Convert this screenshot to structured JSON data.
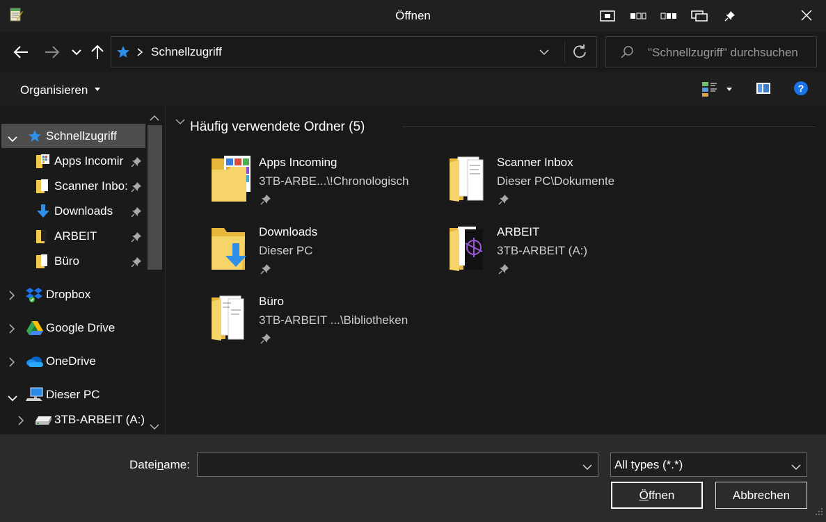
{
  "window": {
    "title": "Öffnen",
    "title_buttons": [
      "window-snap-icon",
      "window-group-icon",
      "window-group2-icon",
      "window-cascade-icon",
      "pin-icon"
    ],
    "close_icon": "close-icon"
  },
  "nav": {
    "back_icon": "back-arrow-icon",
    "forward_icon": "forward-arrow-icon",
    "recent_icon": "chevron-down-icon",
    "up_icon": "up-arrow-icon",
    "address": {
      "icon": "star-icon",
      "path": "Schnellzugriff"
    },
    "search": {
      "placeholder": "\"Schnellzugriff\" durchsuchen"
    }
  },
  "toolbar": {
    "organize_label": "Organisieren"
  },
  "sidebar": {
    "quick_access": {
      "label": "Schnellzugriff",
      "items": [
        {
          "label": "Apps Incomir",
          "pinned": true
        },
        {
          "label": "Scanner Inbo:",
          "pinned": true
        },
        {
          "label": "Downloads",
          "pinned": true
        },
        {
          "label": "ARBEIT",
          "pinned": true
        },
        {
          "label": "Büro",
          "pinned": true
        }
      ]
    },
    "roots": [
      {
        "label": "Dropbox",
        "icon": "dropbox-icon"
      },
      {
        "label": "Google Drive",
        "icon": "google-drive-icon"
      },
      {
        "label": "OneDrive",
        "icon": "onedrive-icon"
      },
      {
        "label": "Dieser PC",
        "icon": "computer-icon"
      }
    ],
    "drives": [
      {
        "label": "3TB-ARBEIT (A:)",
        "icon": "drive-icon"
      }
    ]
  },
  "main": {
    "group_title": "Häufig verwendete Ordner (5)",
    "folders": [
      {
        "name": "Apps Incoming",
        "path": "3TB-ARBE...\\!Chronologisch"
      },
      {
        "name": "Scanner Inbox",
        "path": "Dieser PC\\Dokumente"
      },
      {
        "name": "Downloads",
        "path": "Dieser PC"
      },
      {
        "name": "ARBEIT",
        "path": "3TB-ARBEIT (A:)"
      },
      {
        "name": "Büro",
        "path": "3TB-ARBEIT ...\\Bibliotheken"
      }
    ]
  },
  "footer": {
    "filename_label_pre": "Datei",
    "filename_label_u": "n",
    "filename_label_post": "ame:",
    "filename_value": "",
    "filetype_value": "All types (*.*)",
    "open_label_u": "Ö",
    "open_label_rest": "ffnen",
    "cancel_label": "Abbrechen"
  },
  "colors": {
    "accent_blue": "#1a73e8",
    "folder_yellow": "#f2c94c",
    "selection_gray": "#4d4d4d"
  }
}
